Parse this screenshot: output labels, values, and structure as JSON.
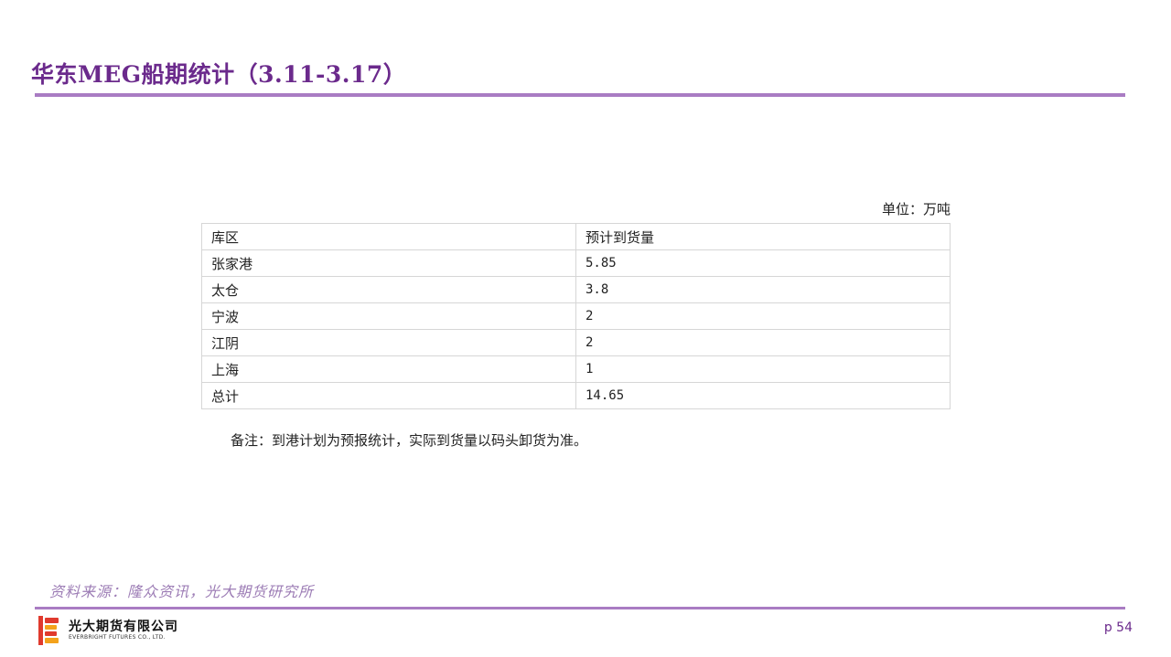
{
  "header": {
    "title": "华东MEG船期统计（3.11-3.17）"
  },
  "unit_label": "单位：万吨",
  "table": {
    "columns": [
      "库区",
      "预计到货量"
    ],
    "rows": [
      {
        "region": "张家港",
        "amount": "5.85"
      },
      {
        "region": "太仓",
        "amount": "3.8"
      },
      {
        "region": "宁波",
        "amount": "2"
      },
      {
        "region": "江阴",
        "amount": "2"
      },
      {
        "region": "上海",
        "amount": "1"
      },
      {
        "region": "总计",
        "amount": "14.65"
      }
    ]
  },
  "note": "备注：到港计划为预报统计，实际到货量以码头卸货为准。",
  "source": "资料来源：隆众资讯，光大期货研究所",
  "footer": {
    "logo_cn": "光大期货有限公司",
    "logo_en": "EVERBRIGHT FUTURES CO., LTD.",
    "page_number": "p 54"
  },
  "colors": {
    "accent": "#6b2a8c",
    "rule": "#a97cc3",
    "logo_red": "#e03a2e",
    "logo_orange": "#f4a21c"
  }
}
